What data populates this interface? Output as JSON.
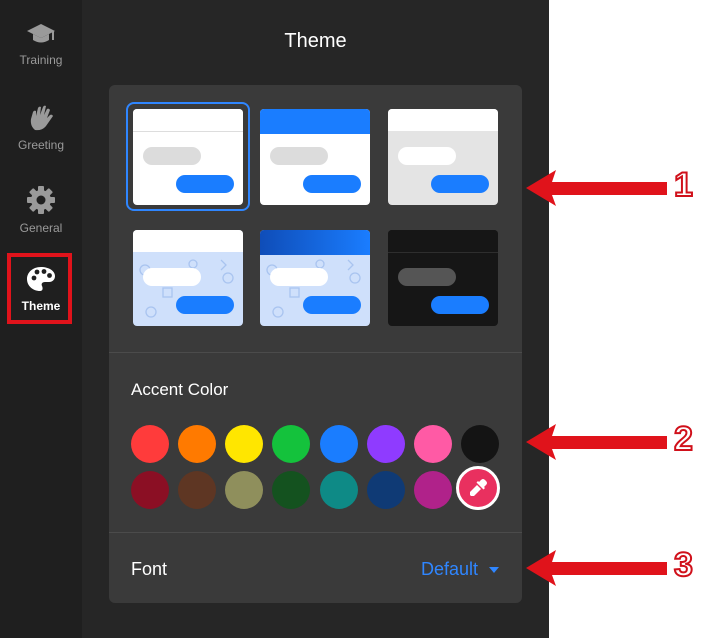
{
  "sidebar": {
    "items": [
      {
        "label": "Training",
        "icon": "graduation-cap-icon"
      },
      {
        "label": "Greeting",
        "icon": "waving-hand-icon"
      },
      {
        "label": "General",
        "icon": "gear-icon"
      },
      {
        "label": "Theme",
        "icon": "palette-icon",
        "active": true
      }
    ]
  },
  "page": {
    "title": "Theme"
  },
  "themes": [
    {
      "name": "light",
      "selected": true
    },
    {
      "name": "blue-header",
      "selected": false
    },
    {
      "name": "gray",
      "selected": false
    },
    {
      "name": "pattern-light",
      "selected": false
    },
    {
      "name": "pattern-blue",
      "selected": false
    },
    {
      "name": "dark",
      "selected": false
    }
  ],
  "accent": {
    "label": "Accent Color",
    "colors": [
      "#ff3b3b",
      "#ff7a00",
      "#ffe600",
      "#14c23c",
      "#1a7dff",
      "#8f3bff",
      "#ff5aa5",
      "#141414",
      "#8b0f24",
      "#5e3623",
      "#8f8f5c",
      "#14521f",
      "#0e8a86",
      "#0f3a75",
      "#b0228a",
      "#e9305f"
    ],
    "picker_icon": "eyedropper-icon"
  },
  "font": {
    "label": "Font",
    "value": "Default"
  },
  "callouts": [
    "1",
    "2",
    "3"
  ]
}
